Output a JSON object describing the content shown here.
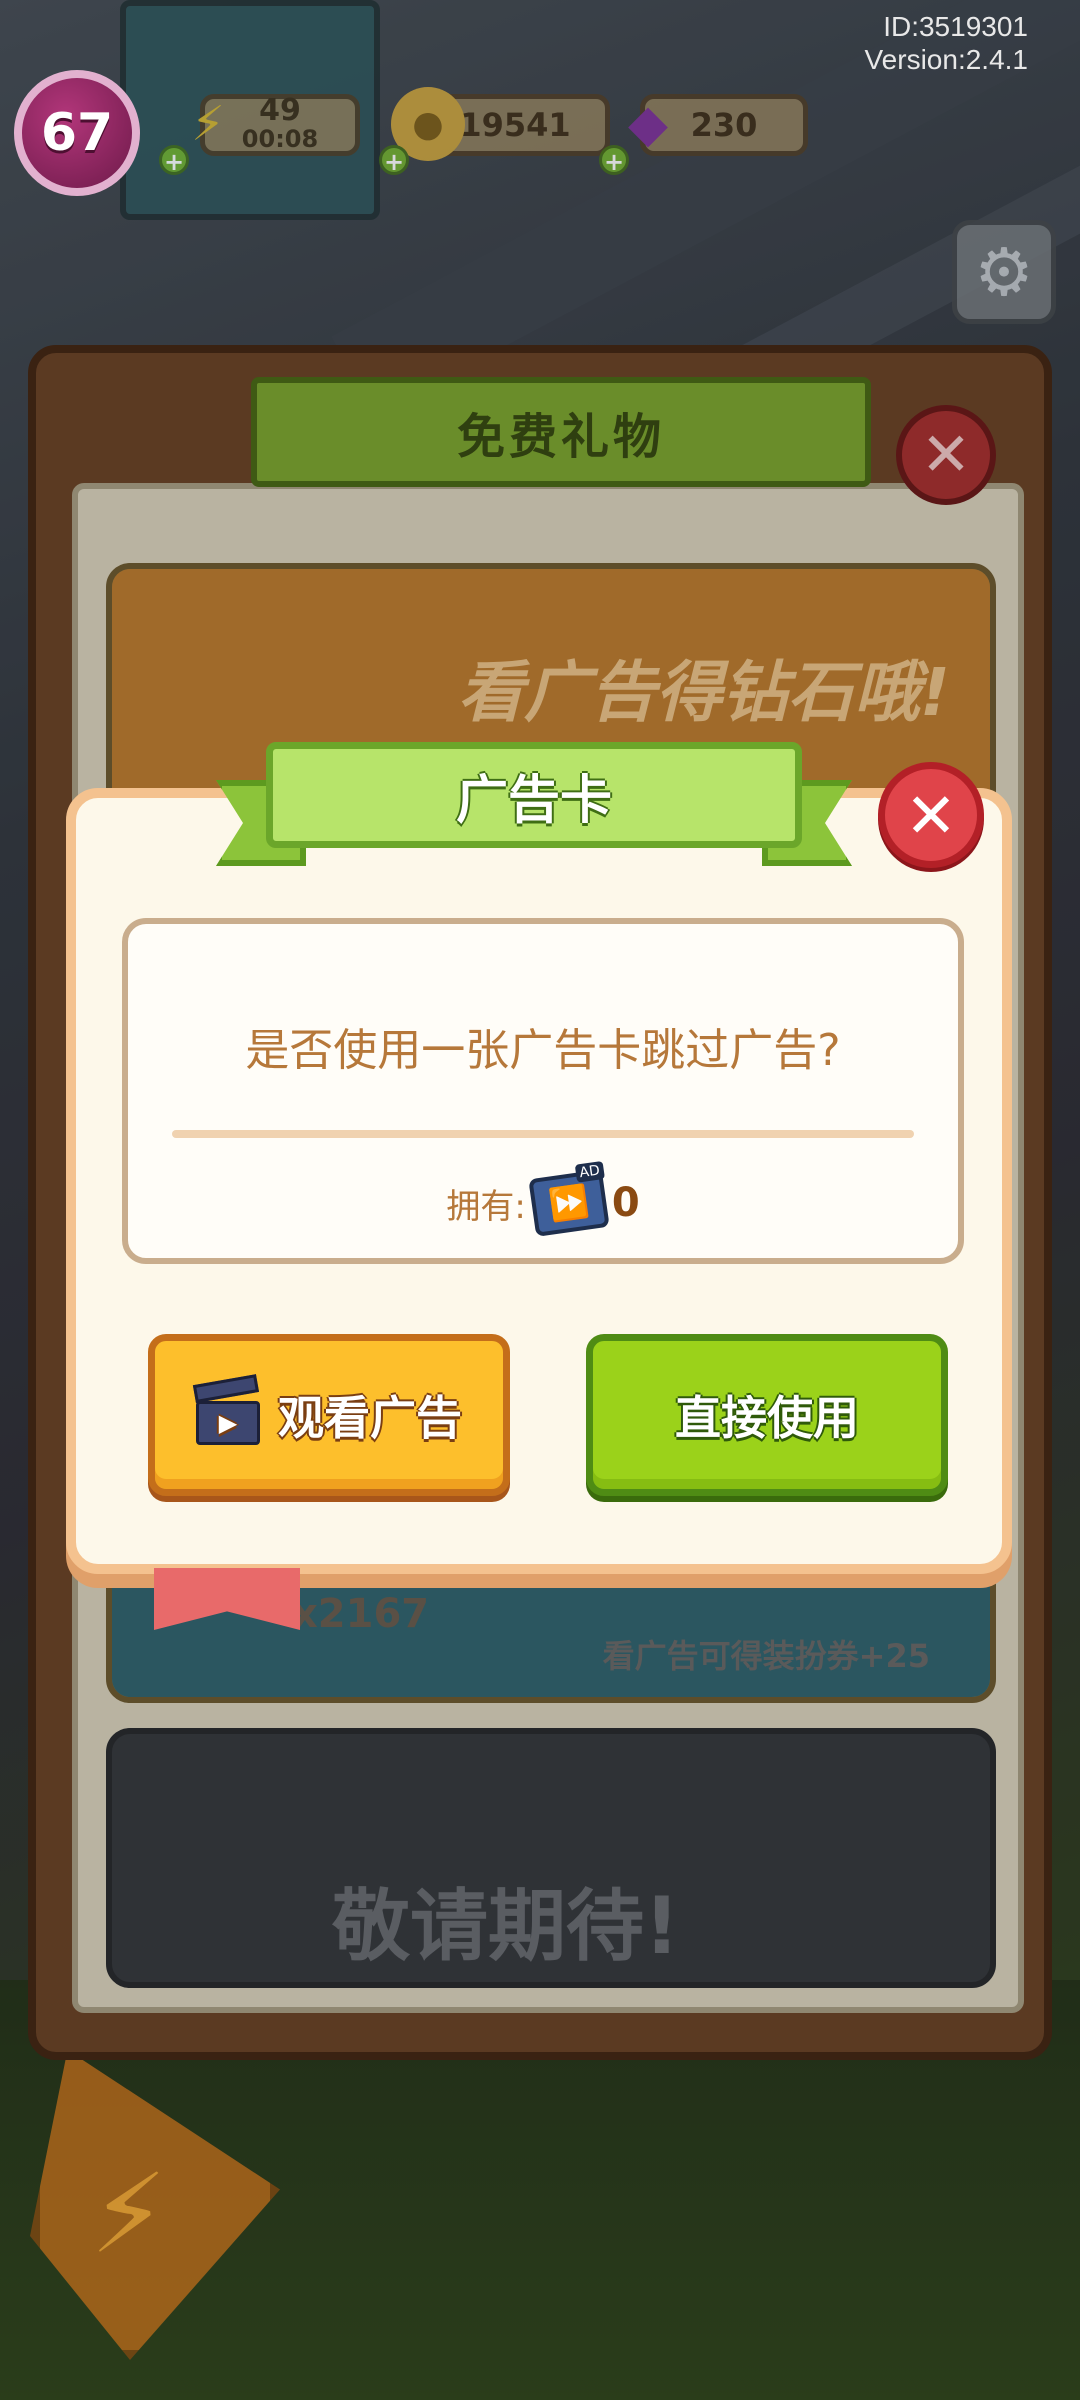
{
  "hud": {
    "id_text": "ID:3519301",
    "version_text": "Version:2.4.1",
    "level": "67",
    "energy": "49",
    "energy_timer": "00:08",
    "coins": "19541",
    "gems": "230",
    "icons": {
      "energy": "lightning-icon",
      "coins": "coin-icon",
      "gems": "gem-icon",
      "settings": "gear-icon"
    }
  },
  "gift_panel": {
    "title": "免费礼物",
    "ad_banner_text": "看广告得钻石哦!",
    "ad_count": "x2167",
    "ad_reward_text": "看广告可得装扮券+25",
    "coming_soon_text": "敬请期待!"
  },
  "modal": {
    "title": "广告卡",
    "message": "是否使用一张广告卡跳过广告?",
    "own_label": "拥有:",
    "own_count": "0",
    "adcard_badge": "AD",
    "watch_button": "观看广告",
    "use_button": "直接使用"
  },
  "colors": {
    "accent_green": "#9bd21a",
    "accent_yellow": "#fdbf2c",
    "close_red": "#e0444a",
    "text_brown": "#b6783a"
  }
}
